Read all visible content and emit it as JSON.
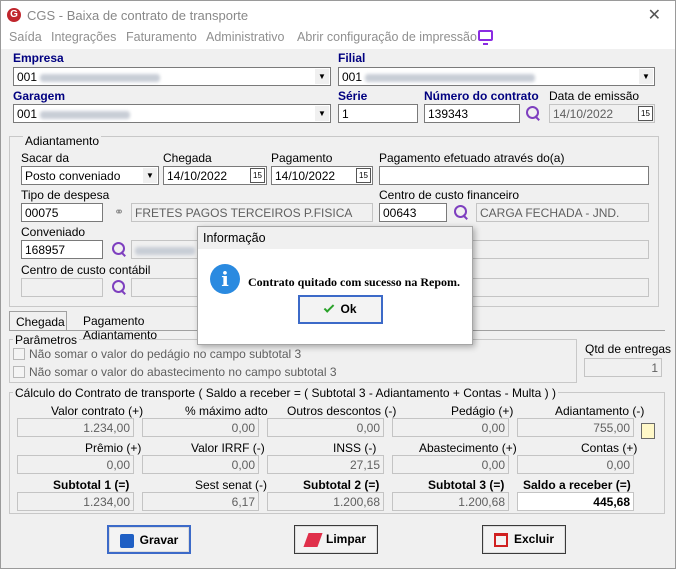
{
  "window": {
    "app": "CGS",
    "title": "CGS - Baixa de contrato de transporte",
    "close": "✕"
  },
  "menu": [
    "Saída",
    "Integrações",
    "Faturamento",
    "Administrativo",
    "Abrir configuração de impressão"
  ],
  "labels": {
    "empresa": "Empresa",
    "filial": "Filial",
    "garagem": "Garagem",
    "serie": "Série",
    "numero_contrato": "Número do contrato",
    "data_emissao": "Data de emissão"
  },
  "values": {
    "empresa": "001",
    "filial": "001",
    "garagem": "001",
    "serie": "1",
    "numero_contrato": "139343",
    "data_emissao": "14/10/2022"
  },
  "adiantamento": {
    "title": "Adiantamento",
    "sacar_de_label": "Sacar da",
    "sacar_de": "Posto conveniado",
    "chegada_label": "Chegada",
    "chegada": "14/10/2022",
    "pagamento_label": "Pagamento",
    "pagamento": "14/10/2022",
    "pag_efetuado_label": "Pagamento efetuado através do(a)",
    "tipo_despesa_label": "Tipo de despesa",
    "tipo_despesa": "00075",
    "tipo_despesa_desc": "FRETES PAGOS TERCEIROS P.FISICA",
    "centro_custo_fin_label": "Centro de custo financeiro",
    "centro_custo_fin": "00643",
    "centro_custo_fin_desc": "CARGA FECHADA - JND.",
    "conveniado_label": "Conveniado",
    "conveniado": "168957",
    "centro_custo_contabil_label": "Centro de custo contábil"
  },
  "tabs": [
    "Chegada",
    "Pagamento Adiantamento"
  ],
  "parametros": {
    "title": "Parâmetros",
    "opt1": "Não somar o valor do pedágio no campo subtotal 3",
    "opt2": "Não somar o valor do abastecimento no campo subtotal 3",
    "qtd_label": "Qtd de entregas",
    "qtd": "1"
  },
  "calculo": {
    "title": "Cálculo do Contrato de transporte ( Saldo a receber = ( Subtotal 3 - Adiantamento + Contas - Multa ) )",
    "valor_contrato_label": "Valor contrato (+)",
    "valor_contrato": "1.234,00",
    "pct_max_label": "% máximo adto",
    "pct_max": "0,00",
    "outros_desc_label": "Outros descontos (-)",
    "outros_desc": "0,00",
    "pedagio_label": "Pedágio (+)",
    "pedagio": "0,00",
    "adiantamento_label": "Adiantamento (-)",
    "adiantamento": "755,00",
    "premio_label": "Prêmio (+)",
    "premio": "0,00",
    "irrf_label": "Valor IRRF (-)",
    "irrf": "0,00",
    "inss_label": "INSS (-)",
    "inss": "27,15",
    "abastecimento_label": "Abastecimento (+)",
    "abastecimento": "0,00",
    "contas_label": "Contas (+)",
    "contas": "0,00",
    "subtotal1_label": "Subtotal 1 (=)",
    "subtotal1": "1.234,00",
    "sest_label": "Sest senat (-)",
    "sest": "6,17",
    "subtotal2_label": "Subtotal 2 (=)",
    "subtotal2": "1.200,68",
    "subtotal3_label": "Subtotal 3 (=)",
    "subtotal3": "1.200,68",
    "saldo_label": "Saldo a receber (=)",
    "saldo": "445,68"
  },
  "buttons": {
    "gravar": "Gravar",
    "limpar": "Limpar",
    "excluir": "Excluir"
  },
  "dialog": {
    "title": "Informação",
    "message": "Contrato quitado com sucesso na Repom.",
    "ok": "Ok",
    "icon": "i"
  },
  "colors": {
    "label_blue": "#000080",
    "focus": "#3c6ac8",
    "icon_purple": "#7e3fbf"
  }
}
